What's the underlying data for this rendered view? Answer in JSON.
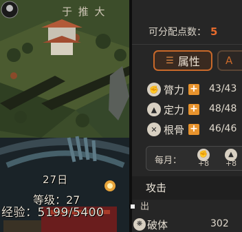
{
  "game": {
    "banner_text": "于 推 大",
    "day": "27日",
    "level": "等级：27",
    "experience": "经验：5199/5400"
  },
  "panel": {
    "points_label": "可分配点数：",
    "points_value": "5",
    "tabs": [
      {
        "label": "属性",
        "icon": "attribute-icon",
        "active": true
      },
      {
        "label": "A",
        "icon": "next-tab-icon",
        "active": false
      }
    ],
    "stats": [
      {
        "label": "膂力",
        "icon": "strength-icon",
        "value": "43/43"
      },
      {
        "label": "定力",
        "icon": "focus-icon",
        "value": "48/48"
      },
      {
        "label": "根骨",
        "icon": "constitution-icon",
        "value": "46/46"
      }
    ],
    "monthly": {
      "label": "每月：",
      "bonuses": [
        {
          "icon": "strength-icon",
          "value": "+8"
        },
        {
          "icon": "focus-icon",
          "value": "+8"
        }
      ]
    },
    "section_title": "攻击",
    "sub_title": "出",
    "break_label": "破体",
    "break_value": "302"
  },
  "colors": {
    "accent": "#e86b2c",
    "plus_button": "#e8932d",
    "panel_bg": "#262626"
  }
}
